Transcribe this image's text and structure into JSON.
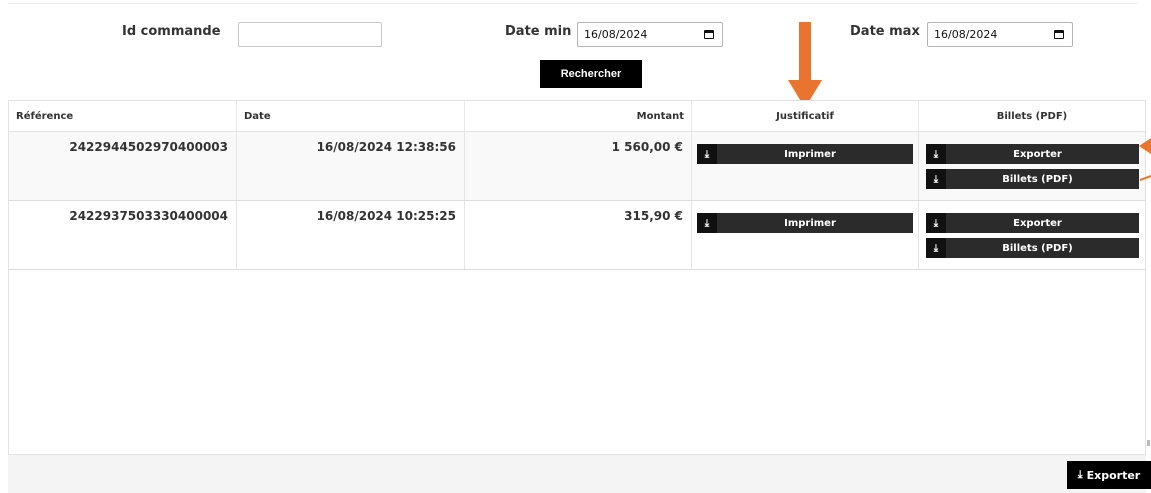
{
  "filters": {
    "id_label": "Id commande",
    "id_value": "",
    "date_min_label": "Date min",
    "date_min_value": "16/08/2024",
    "date_max_label": "Date max",
    "date_max_value": "16/08/2024",
    "search_label": "Rechercher"
  },
  "table": {
    "columns": [
      "Référence",
      "Date",
      "Montant",
      "Justificatif",
      "Billets (PDF)"
    ],
    "rows": [
      {
        "reference": "2422944502970400003",
        "date": "16/08/2024 12:38:56",
        "montant": "1 560,00 €",
        "justificatif_label": "Imprimer",
        "export_label": "Exporter",
        "billets_label": "Billets (PDF)"
      },
      {
        "reference": "2422937503330400004",
        "date": "16/08/2024 10:25:25",
        "montant": "315,90 €",
        "justificatif_label": "Imprimer",
        "export_label": "Exporter",
        "billets_label": "Billets (PDF)"
      }
    ]
  },
  "footer": {
    "export_label": "Exporter"
  },
  "icons": {
    "download": "download-icon",
    "calendar": "calendar-icon"
  },
  "colors": {
    "accent": "#e8742f",
    "button": "#2b2b2b",
    "button_icon": "#111111"
  }
}
